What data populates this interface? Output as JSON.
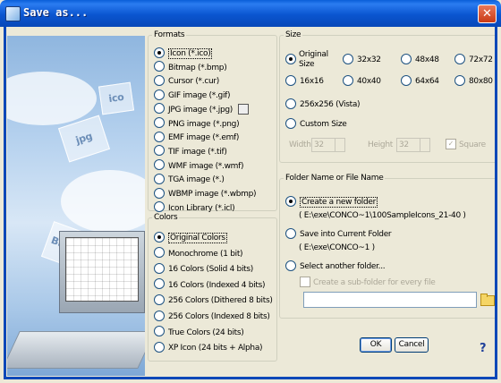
{
  "window": {
    "title": "Save as...",
    "close_glyph": "✕",
    "title_icon": "app-icon"
  },
  "picture": {
    "label_jpg": "jpg",
    "label_bmp": "Bmp",
    "label_ico": "ico"
  },
  "formats": {
    "legend": "Formats",
    "selected": 0,
    "options": [
      "Icon (*.ico)",
      "Bitmap (*.bmp)",
      "Cursor (*.cur)",
      "GIF image (*.gif)",
      "JPG image (*.jpg)",
      "PNG image (*.png)",
      "EMF image (*.emf)",
      "TIF image (*.tif)",
      "WMF image (*.wmf)",
      "TGA image (*.)",
      "WBMP image (*.wbmp)",
      "Icon Library (*.icl)"
    ]
  },
  "colors": {
    "legend": "Colors",
    "selected": 0,
    "options": [
      "Original Colors",
      "Monochrome (1 bit)",
      "16 Colors (Solid 4 bits)",
      "16 Colors (Indexed 4 bits)",
      "256 Colors (Dithered 8 bits)",
      "256 Colors (Indexed 8 bits)",
      "True Colors (24 bits)",
      "XP Icon (24 bits + Alpha)"
    ]
  },
  "size": {
    "legend": "Size",
    "original": "Original",
    "original2": "Size",
    "options": [
      "32x32",
      "48x48",
      "72x72",
      "16x16",
      "40x40",
      "64x64",
      "80x80"
    ],
    "vista": "256x256 (Vista)",
    "custom_legend": "Custom Size",
    "width_label": "Width",
    "width_value": "32",
    "height_label": "Height",
    "height_value": "32",
    "square_label": "Square",
    "square_checked": "✓"
  },
  "folder": {
    "legend": "Folder Name or File Name",
    "create_label": "Create a new folder",
    "create_path": "( E:\\exe\\CONCO~1\\100SampleIcons_21-40 )",
    "save_current_label": "Save into Current Folder",
    "save_current_path": "( E:\\exe\\CONCO~1 )",
    "another_label": "Select another folder...",
    "subfolder_label": "Create a sub-folder for every file",
    "path_value": ""
  },
  "buttons": {
    "ok": "OK",
    "cancel": "Cancel",
    "help": "?"
  }
}
